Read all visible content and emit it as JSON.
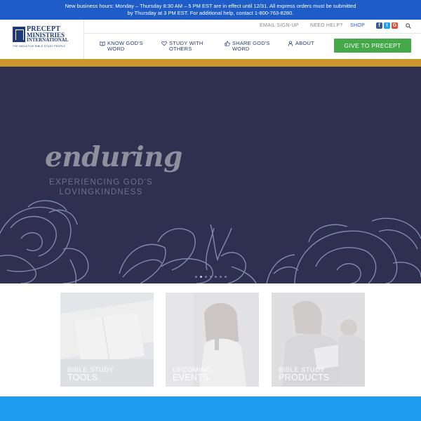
{
  "announcement": {
    "line1": "New business hours: Monday – Thursday 8:30 AM – 5 PM EST are in effect until 12/31. All express orders must be submitted",
    "line2": "by Thursday at 3 PM EST. For additional help, contact 1-800-763-8280."
  },
  "logo": {
    "line1": "PRECEPT",
    "line2": "MINISTRIES",
    "line3": "INTERNATIONAL",
    "tagline": "THE INDUCTIVE BIBLE STUDY PEOPLE",
    "color": "#1e3a78"
  },
  "utility": {
    "email_signup": "EMAIL SIGN-UP",
    "need_help": "NEED HELP?",
    "shop": "SHOP",
    "social": [
      {
        "icon": "facebook-icon",
        "glyph": "f",
        "color": "#3b5998"
      },
      {
        "icon": "twitter-icon",
        "glyph": "t",
        "color": "#1da1f2"
      },
      {
        "icon": "google-plus-icon",
        "glyph": "G",
        "color": "#dd4b39"
      }
    ]
  },
  "nav": {
    "items": [
      {
        "label_line1": "KNOW GOD'S",
        "label_line2": "WORD",
        "icon": "book-icon"
      },
      {
        "label_line1": "STUDY WITH",
        "label_line2": "OTHERS",
        "icon": "heart-icon"
      },
      {
        "label_line1": "SHARE GOD'S",
        "label_line2": "WORD",
        "icon": "thumbs-up-icon"
      },
      {
        "label_line1": "ABOUT",
        "label_line2": "",
        "icon": "person-icon"
      }
    ],
    "cta": "GIVE TO PRECEPT"
  },
  "hero": {
    "title": "enduring",
    "subtitle_line1": "EXPERIENCING GOD'S",
    "subtitle_line2": "LOVINGKINDNESS",
    "slide_count": 7,
    "active_slide": 1
  },
  "cards": [
    {
      "line1": "BIBLE STUDY",
      "line2": "TOOLS"
    },
    {
      "line1": "UPCOMING",
      "line2": "EVENTS"
    },
    {
      "line1": "BIBLE STUDY",
      "line2": "PRODUCTS"
    }
  ],
  "colors": {
    "announcement_bg": "#1e5cc8",
    "gold": "#c9982f",
    "hero_bg": "#2f3050",
    "give_button": "#45a94a",
    "band": "#1e9cef"
  }
}
